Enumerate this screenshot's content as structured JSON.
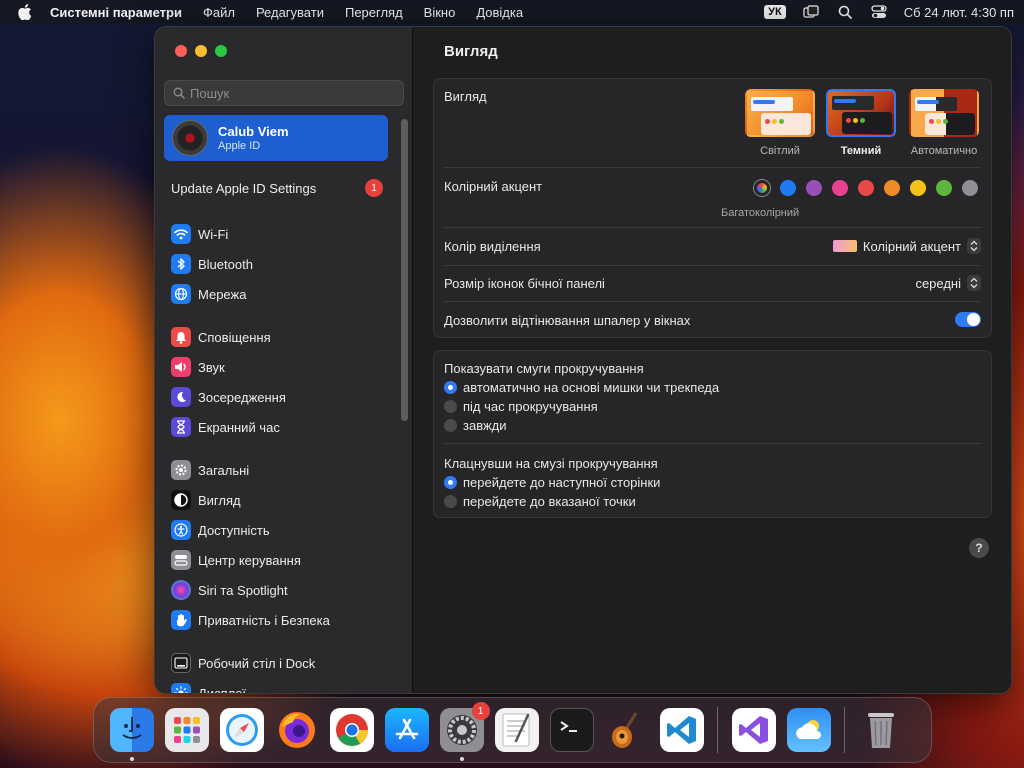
{
  "menubar": {
    "app_name": "Системні параметри",
    "items": [
      "Файл",
      "Редагувати",
      "Перегляд",
      "Вікно",
      "Довідка"
    ],
    "input_lang": "УК",
    "clock": "Сб 24 лют.  4:30 пп"
  },
  "sidebar": {
    "search_placeholder": "Пошук",
    "account": {
      "name": "Calub Viem",
      "subtitle": "Apple ID"
    },
    "update": {
      "label": "Update Apple ID Settings",
      "badge": "1"
    },
    "items": [
      {
        "label": "Wi-Fi",
        "icon": "wifi-icon",
        "color": "#1e7bf2"
      },
      {
        "label": "Bluetooth",
        "icon": "bluetooth-icon",
        "color": "#1e7bf2"
      },
      {
        "label": "Мережа",
        "icon": "globe-icon",
        "color": "#1e7bf2"
      },
      {
        "label": "Сповіщення",
        "icon": "bell-icon",
        "color": "#ee4a4a"
      },
      {
        "label": "Звук",
        "icon": "speaker-icon",
        "color": "#ee3f6c"
      },
      {
        "label": "Зосередження",
        "icon": "moon-icon",
        "color": "#5a4ad8"
      },
      {
        "label": "Екранний час",
        "icon": "hourglass-icon",
        "color": "#5a4ad8"
      },
      {
        "label": "Загальні",
        "icon": "gear-icon",
        "color": "#8e8e93"
      },
      {
        "label": "Вигляд",
        "icon": "appearance-icon",
        "color": "#111111"
      },
      {
        "label": "Доступність",
        "icon": "accessibility-icon",
        "color": "#1e7bf2"
      },
      {
        "label": "Центр керування",
        "icon": "control-center-icon",
        "color": "#8e8e93"
      },
      {
        "label": "Siri та Spotlight",
        "icon": "siri-icon",
        "color": "#7a3bd8"
      },
      {
        "label": "Приватність і Безпека",
        "icon": "hand-icon",
        "color": "#1e7bf2"
      },
      {
        "label": "Робочий стіл і Dock",
        "icon": "dock-icon",
        "color": "#1b1b1b"
      },
      {
        "label": "Дисплеї",
        "icon": "display-icon",
        "color": "#1e7bf2"
      }
    ]
  },
  "main": {
    "title": "Вигляд",
    "appearance": {
      "label": "Вигляд",
      "options": [
        {
          "caption": "Світлий",
          "selected": false
        },
        {
          "caption": "Темний",
          "selected": true
        },
        {
          "caption": "Автоматично",
          "selected": false
        }
      ]
    },
    "accent": {
      "label": "Колірний акцент",
      "caption": "Багатоколірний",
      "colors": [
        "multicolor",
        "#1e7bf2",
        "#9a4fb8",
        "#e8418e",
        "#eb4848",
        "#f08a24",
        "#f5c21a",
        "#5db53e",
        "#8e8e93"
      ]
    },
    "highlight": {
      "label": "Колір виділення",
      "value": "Колірний акцент"
    },
    "sidebar_icon_size": {
      "label": "Розмір іконок бічної панелі",
      "value": "середні"
    },
    "wallpaper_tinting": {
      "label": "Дозволити відтінювання шпалер у вікнах",
      "enabled": true
    },
    "scrollbars": {
      "label": "Показувати смуги прокручування",
      "options": [
        {
          "label": "автоматично на основі мишки чи трекпеда",
          "checked": true
        },
        {
          "label": "під час прокручування",
          "checked": false
        },
        {
          "label": "завжди",
          "checked": false
        }
      ]
    },
    "click_scrollbar": {
      "label": "Клацнувши на смузі прокручування",
      "options": [
        {
          "label": "перейдете до наступної сторінки",
          "checked": true
        },
        {
          "label": "перейдете до вказаної точки",
          "checked": false
        }
      ]
    },
    "help_label": "?"
  },
  "dock": {
    "apps": [
      {
        "name": "Finder",
        "icon": "finder-icon",
        "running": true
      },
      {
        "name": "Launchpad",
        "icon": "launchpad-icon",
        "running": false
      },
      {
        "name": "Safari",
        "icon": "safari-icon",
        "running": false
      },
      {
        "name": "Firefox",
        "icon": "firefox-icon",
        "running": false
      },
      {
        "name": "Chrome",
        "icon": "chrome-icon",
        "running": false
      },
      {
        "name": "App Store",
        "icon": "app-store-icon",
        "running": false
      },
      {
        "name": "System Settings",
        "icon": "system-settings-icon",
        "running": true,
        "badge": "1"
      },
      {
        "name": "TextEdit",
        "icon": "textedit-icon",
        "running": false
      },
      {
        "name": "Terminal",
        "icon": "terminal-icon",
        "running": false
      },
      {
        "name": "GarageBand",
        "icon": "garageband-icon",
        "running": false
      },
      {
        "name": "Visual Studio Code",
        "icon": "vscode-icon",
        "running": false
      }
    ],
    "recent": [
      {
        "name": "Visual Studio",
        "icon": "visual-studio-icon"
      },
      {
        "name": "Weather",
        "icon": "weather-icon"
      }
    ],
    "trash": {
      "name": "Trash",
      "icon": "trash-icon"
    }
  }
}
